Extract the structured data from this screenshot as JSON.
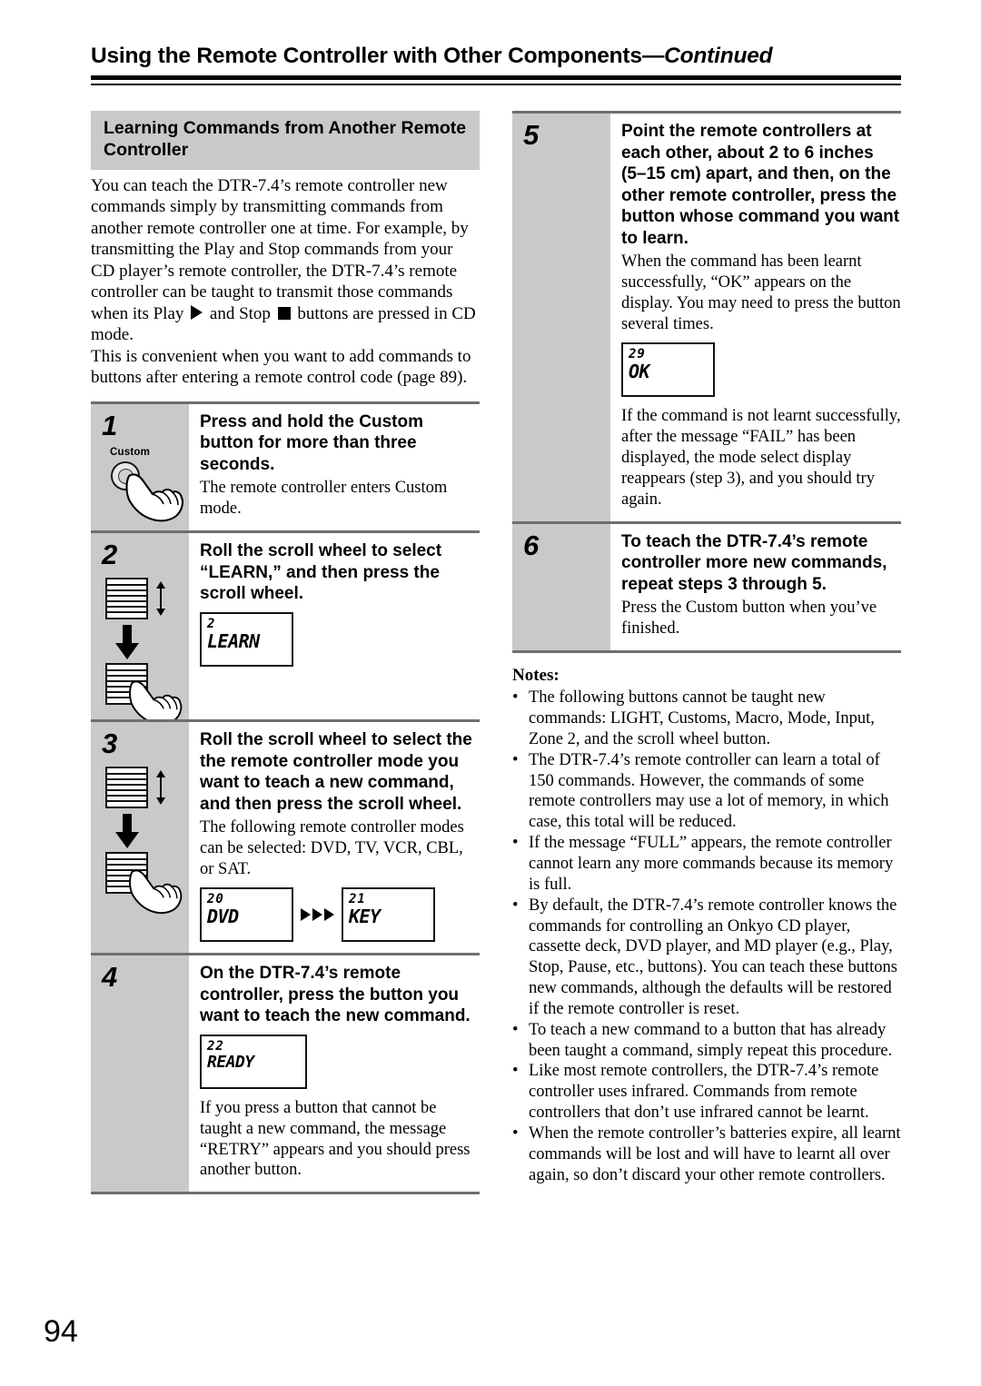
{
  "header": {
    "title_main": "Using the Remote Controller with Other Components",
    "title_sep": "—",
    "title_cont": "Continued"
  },
  "section": {
    "heading": "Learning Commands from Another Remote Controller",
    "intro_p1_a": "You can teach the DTR-7.4’s remote controller new commands simply by transmitting commands from another remote controller one at time. For example, by transmitting the Play and Stop commands from your CD player’s remote controller, the DTR-7.4’s remote controller can be taught to transmit those commands when its Play ",
    "intro_p1_b": " and Stop ",
    "intro_p1_c": " buttons are pressed in CD mode.",
    "intro_p2": "This is convenient when you want to add commands to buttons after entering a remote control code (page 89)."
  },
  "steps": [
    {
      "number": "1",
      "title": "Press and hold the Custom button for more than three seconds.",
      "desc": "The remote controller enters Custom mode.",
      "icon": "custom-button-press",
      "button_label": "Custom"
    },
    {
      "number": "2",
      "title": "Roll the scroll wheel to select “LEARN,” and then press the scroll wheel.",
      "desc": "",
      "icon": "scroll-wheel-press",
      "lcd": {
        "num": "2",
        "text": "LEARN"
      }
    },
    {
      "number": "3",
      "title": "Roll the scroll wheel to select the the remote controller mode you want to teach a new command, and then press the scroll wheel.",
      "desc": "The following remote controller modes can be selected: DVD, TV, VCR, CBL, or SAT.",
      "icon": "scroll-wheel-press",
      "lcd_from": {
        "num": "20",
        "text": "DVD"
      },
      "lcd_to": {
        "num": "21",
        "text": "KEY"
      }
    },
    {
      "number": "4",
      "title": "On the DTR-7.4’s remote controller, press the button you want to teach the new command.",
      "lcd": {
        "num": "22",
        "text": "READY"
      },
      "desc": "If you press a button that cannot be taught a new command, the message “RETRY” appears and you should press another button."
    },
    {
      "number": "5",
      "title": "Point the remote controllers at each other, about 2 to 6 inches (5–15 cm) apart, and then, on the other remote controller, press the button whose command you want to learn.",
      "desc": "When the command has been learnt successfully, “OK” appears on the display. You may need to press the button several times.",
      "lcd": {
        "num": "29",
        "text": "OK"
      },
      "desc2": "If the command is not learnt successfully, after the message “FAIL” has been displayed, the mode select display reappears (step 3), and you should try again."
    },
    {
      "number": "6",
      "title": "To teach the DTR-7.4’s remote controller more new commands, repeat steps 3 through 5.",
      "desc": "Press the Custom button when you’ve finished."
    }
  ],
  "notes": {
    "label": "Notes:",
    "bullet": "•",
    "items": [
      "The following buttons cannot be taught new commands: LIGHT, Customs, Macro, Mode, Input, Zone 2, and the scroll wheel button.",
      "The DTR-7.4’s remote controller can learn a total of 150 commands. However, the commands of some remote controllers may use a lot of memory, in which case, this total will be reduced.",
      "If the message “FULL” appears, the remote controller cannot learn any more commands because its memory is full.",
      "By default, the DTR-7.4’s remote controller knows the commands for controlling an Onkyo CD player, cassette deck, DVD player, and MD player (e.g., Play, Stop, Pause, etc., buttons). You can teach these buttons new commands, although the defaults will be restored if the remote controller is reset.",
      "To teach a new command to a button that has already been taught a command, simply repeat this procedure.",
      "Like most remote controllers, the DTR-7.4’s remote controller uses infrared. Commands from remote controllers that don’t use infrared cannot be learnt.",
      "When the remote controller’s batteries expire, all learnt commands will be lost and will have to learnt all over again, so don’t discard your other remote controllers."
    ]
  },
  "page_number": "94",
  "colors": {
    "band_grey": "#c9c9c9",
    "rule_grey": "#6e6e6e",
    "ink": "#000000"
  }
}
